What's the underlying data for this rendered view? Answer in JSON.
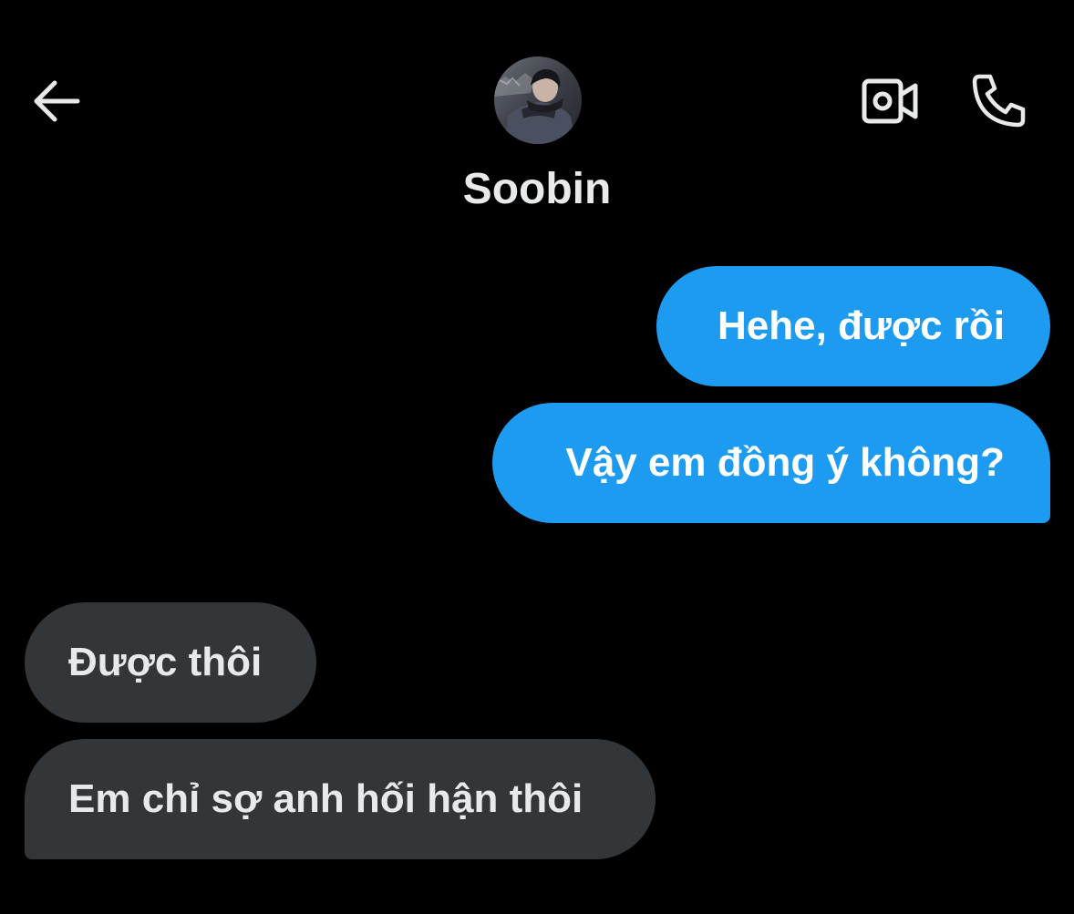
{
  "header": {
    "contact_name": "Soobin"
  },
  "icons": {
    "back": "arrow-left-icon",
    "video_call": "video-camera-icon",
    "voice_call": "phone-icon"
  },
  "messages": [
    {
      "direction": "sent",
      "text": "Hehe, được rồi"
    },
    {
      "direction": "sent",
      "text": "Vậy em đồng ý không?"
    },
    {
      "direction": "received",
      "text": "Được thôi"
    },
    {
      "direction": "received",
      "text": "Em chỉ sợ anh hối hận thôi"
    }
  ],
  "colors": {
    "background": "#000000",
    "sent_bubble": "#1d9bf0",
    "received_bubble": "#333639",
    "text": "#e7e9ea"
  }
}
